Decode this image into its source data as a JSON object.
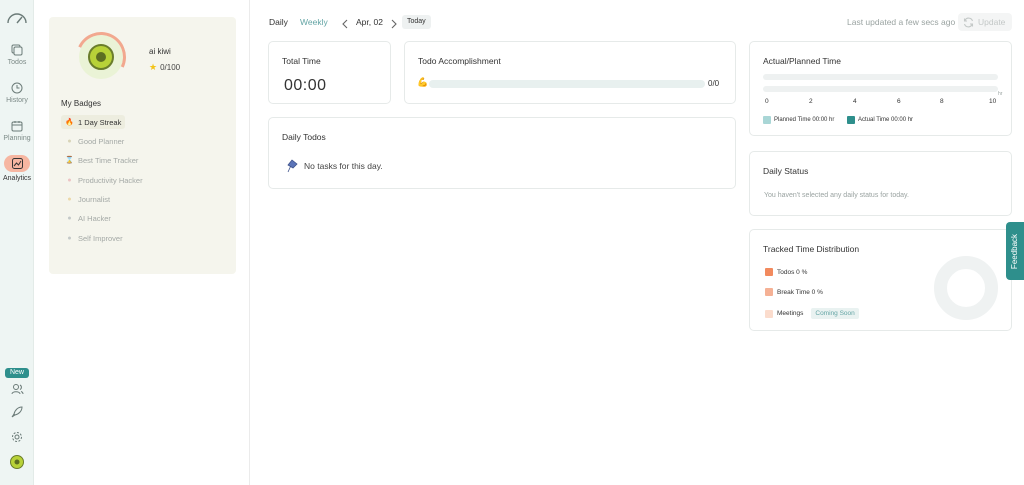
{
  "nav": {
    "items": [
      {
        "label": "Todos",
        "icon": "todos-icon"
      },
      {
        "label": "History",
        "icon": "history-icon"
      },
      {
        "label": "Planning",
        "icon": "planning-icon"
      },
      {
        "label": "Analytics",
        "icon": "analytics-icon",
        "active": true
      }
    ],
    "new_badge": "New"
  },
  "profile": {
    "name": "ai kiwi",
    "points": "0/100",
    "badges_title": "My Badges",
    "badges": [
      {
        "label": "1 Day Streak",
        "icon": "🔥",
        "earned": true
      },
      {
        "label": "Good Planner",
        "icon": "●",
        "earned": false
      },
      {
        "label": "Best Time Tracker",
        "icon": "⌛",
        "earned": false
      },
      {
        "label": "Productivity Hacker",
        "icon": "●",
        "earned": false
      },
      {
        "label": "Journalist",
        "icon": "●",
        "earned": false
      },
      {
        "label": "AI Hacker",
        "icon": "●",
        "earned": false
      },
      {
        "label": "Self Improver",
        "icon": "●",
        "earned": false
      }
    ]
  },
  "topbar": {
    "tab_daily": "Daily",
    "tab_weekly": "Weekly",
    "date": "Apr, 02",
    "today": "Today",
    "last_updated": "Last updated a few secs ago",
    "update": "Update"
  },
  "total_time": {
    "title": "Total Time",
    "value": "00:00"
  },
  "todo_accomplishment": {
    "title": "Todo Accomplishment",
    "count": "0/0",
    "fraction": 0
  },
  "daily_todos": {
    "title": "Daily Todos",
    "empty_message": "No tasks for this day."
  },
  "planned_time": {
    "title": "Actual/Planned Time",
    "ticks": [
      "0",
      "2",
      "4",
      "6",
      "8",
      "10"
    ],
    "unit": "hr",
    "planned_value": 0,
    "actual_value": 0,
    "max": 10,
    "legend_planned": "Planned Time 00:00 hr",
    "legend_actual": "Actual Time 00:00 hr",
    "planned_color": "#a9d6d6",
    "actual_color": "#2e8f8c"
  },
  "daily_status": {
    "title": "Daily Status",
    "message": "You haven't selected any daily status for today."
  },
  "distribution": {
    "title": "Tracked Time Distribution",
    "items": [
      {
        "label": "Todos 0 %",
        "color": "#f28a5e"
      },
      {
        "label": "Break Time 0 %",
        "color": "#f5b195"
      },
      {
        "label": "Meetings",
        "color": "#fbdccd",
        "tag": "Coming Soon"
      }
    ]
  },
  "feedback": "Feedback"
}
